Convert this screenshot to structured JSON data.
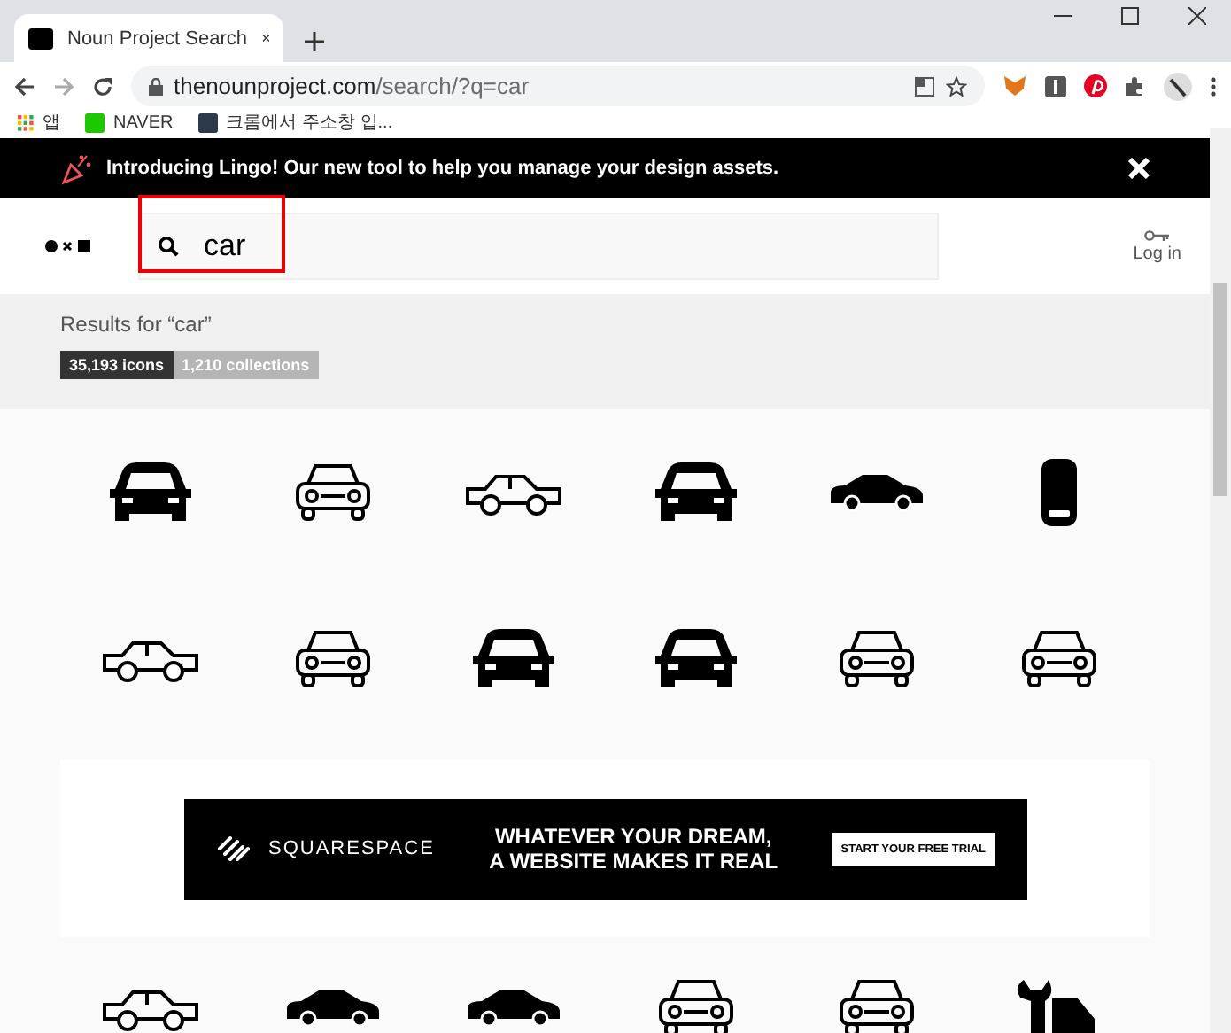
{
  "browser": {
    "tab_title": "Noun Project Search",
    "url_host": "thenounproject.com",
    "url_path": "/search/?q=car",
    "bookmarks": [
      {
        "label": "앱"
      },
      {
        "label": "NAVER"
      },
      {
        "label": "크롬에서 주소창 입..."
      }
    ]
  },
  "banner": {
    "text": "Introducing Lingo! Our new tool to help you manage your design assets."
  },
  "header": {
    "search_value": "car",
    "login": "Log in"
  },
  "results": {
    "heading": "Results for “car”",
    "tabs": [
      {
        "label": "35,193 icons",
        "selected": true
      },
      {
        "label": "1,210 collections",
        "selected": false
      }
    ]
  },
  "ad": {
    "brand": "SQUARESPACE",
    "headline": "WHATEVER YOUR DREAM,\nA WEBSITE MAKES IT REAL",
    "cta": "START YOUR FREE TRIAL"
  }
}
